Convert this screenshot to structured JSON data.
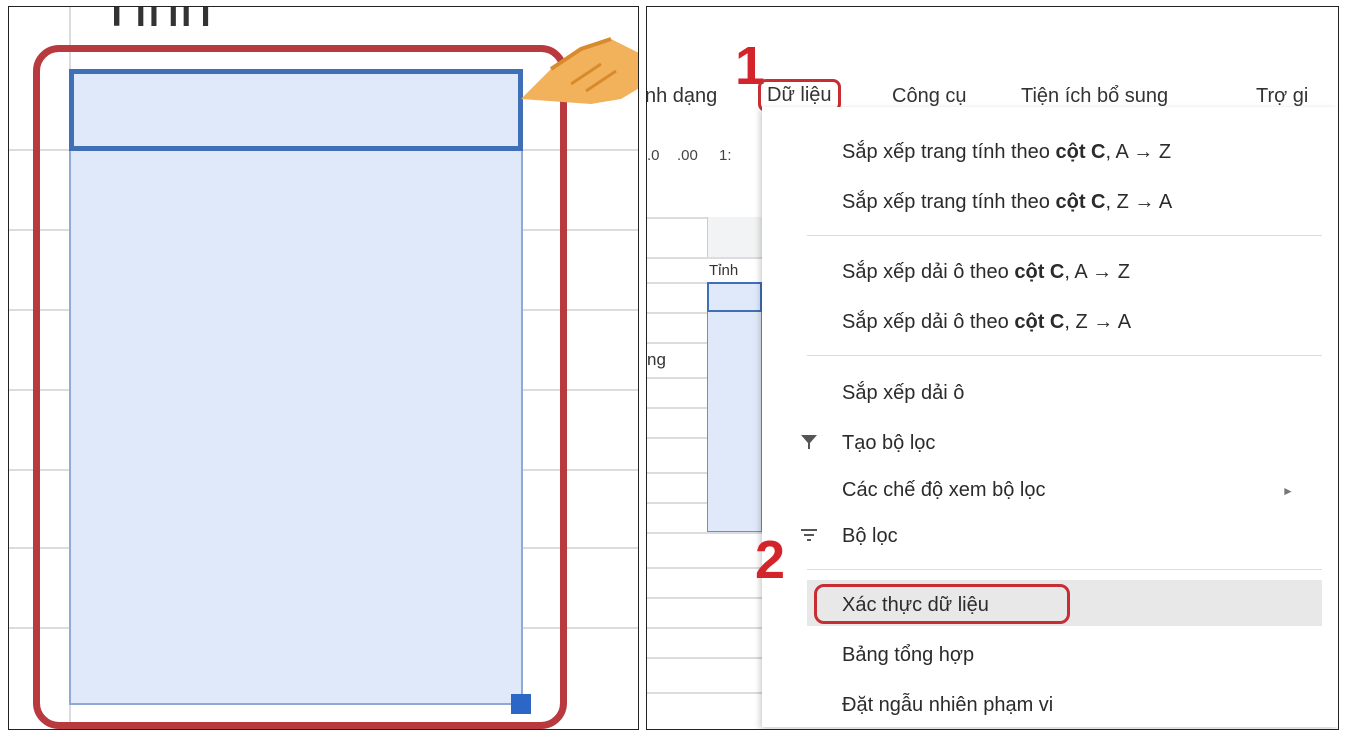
{
  "left_panel": {
    "column_header": "Tỉnh"
  },
  "right_panel": {
    "step1_label": "1",
    "step2_label": "2",
    "menubar": {
      "partial_left": "nh dạng",
      "active": "Dữ liệu",
      "items": [
        "Công cụ",
        "Tiện ích bổ sung",
        "Trợ gi"
      ]
    },
    "toolbar": {
      "dec_decrease": ".0",
      "dec_increase": ".00",
      "partial": "1:"
    },
    "sheet": {
      "header_cell": "Tỉnh",
      "partial_cell": "ng"
    },
    "menu": {
      "sort_sheet_az_pre": "Sắp xếp trang tính theo ",
      "sort_sheet_az_bold": "cột C",
      "sort_sheet_az_post": ", A → Z",
      "sort_sheet_za_pre": "Sắp xếp trang tính theo ",
      "sort_sheet_za_bold": "cột C",
      "sort_sheet_za_post": ", Z → A",
      "sort_range_az_pre": "Sắp xếp dải ô theo ",
      "sort_range_az_bold": "cột C",
      "sort_range_az_post": ", A → Z",
      "sort_range_za_pre": "Sắp xếp dải ô theo ",
      "sort_range_za_bold": "cột C",
      "sort_range_za_post": ", Z → A",
      "sort_range": "Sắp xếp dải ô",
      "create_filter": "Tạo bộ lọc",
      "filter_views": "Các chế độ xem bộ lọc",
      "filter": "Bộ lọc",
      "data_validation": "Xác thực dữ liệu",
      "pivot_table": "Bảng tổng hợp",
      "randomize_range": "Đặt ngẫu nhiên phạm vi"
    },
    "colors": {
      "highlight_red": "#c62e33",
      "selection_blue": "#dfe9f9"
    }
  }
}
